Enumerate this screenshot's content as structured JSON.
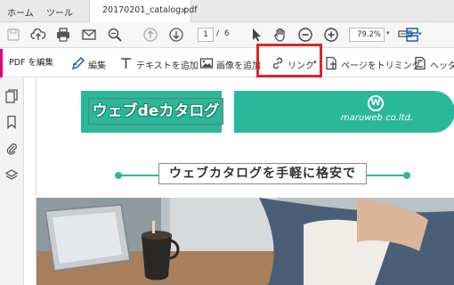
{
  "tabs": {
    "home": "ホーム",
    "tools": "ツール",
    "document": "20170201_catalog.pdf",
    "close_glyph": "×"
  },
  "toolbar": {
    "icons": [
      "save-icon",
      "cloud-upload-icon",
      "print-icon",
      "email-icon",
      "zoom-out-search-icon",
      "page-up-icon",
      "page-down-icon",
      "select-cursor-icon",
      "hand-icon",
      "zoom-out-icon",
      "zoom-in-icon",
      "keyboard-icon",
      "page-layout-icon"
    ],
    "current_page": "1",
    "page_separator": "/",
    "total_pages": "6",
    "zoom": "79.2%",
    "dropdown_glyph": "▾"
  },
  "edit_toolbar": {
    "label": "PDF を編集",
    "tools": [
      {
        "label": "編集",
        "icon": "edit-icon"
      },
      {
        "label": "テキストを追加",
        "icon": "text-add-icon"
      },
      {
        "label": "画像を追加",
        "icon": "image-add-icon"
      },
      {
        "label": "リンク",
        "icon": "link-icon"
      },
      {
        "label": "ページをトリミング",
        "icon": "crop-page-icon"
      },
      {
        "label": "ヘッダー",
        "icon": "header-footer-icon"
      }
    ],
    "link_arrow": "▾"
  },
  "sidebar": {
    "icons": [
      "pages-icon",
      "bookmark-icon",
      "attachment-icon",
      "layers-icon"
    ]
  },
  "document": {
    "banner_title": "ウェブdeカタログ",
    "logo_letter": "W",
    "logo_text": "maruweb co.ltd.",
    "heading": "ウェブカタログを手軽に格安で"
  },
  "colors": {
    "accent": "#2ab89a",
    "pdf_edit_accent": "#e2007a",
    "highlight": "#e0242c",
    "tool_blue": "#1a5fb4"
  }
}
